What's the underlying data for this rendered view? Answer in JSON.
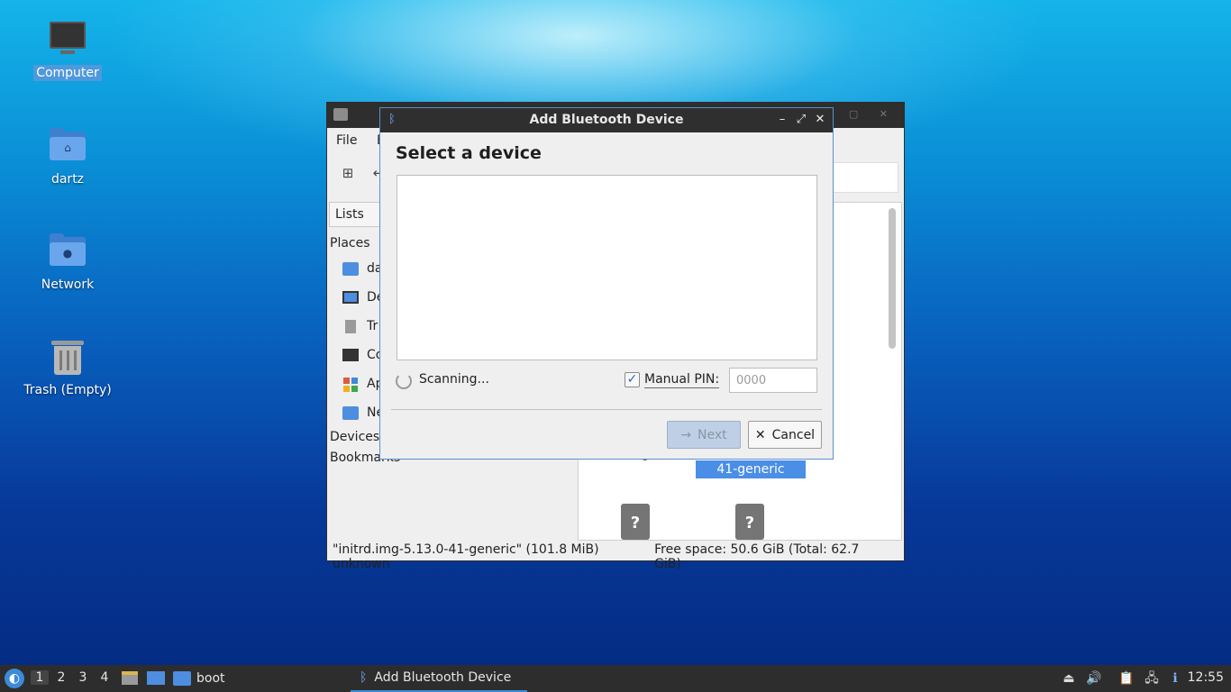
{
  "desktop": {
    "icons": [
      {
        "label": "Computer",
        "icon": "computer-icon",
        "selected": true
      },
      {
        "label": "dartz",
        "icon": "home-folder-icon"
      },
      {
        "label": "Network",
        "icon": "network-folder-icon"
      },
      {
        "label": "Trash (Empty)",
        "icon": "trash-icon"
      }
    ]
  },
  "file_manager": {
    "menu": [
      "File",
      "E"
    ],
    "side_tab": "Lists",
    "places_heading": "Places",
    "places": [
      {
        "label": "da",
        "icon": "home-folder-icon"
      },
      {
        "label": "De",
        "icon": "desktop-icon"
      },
      {
        "label": "Tr",
        "icon": "trash-icon"
      },
      {
        "label": "Co",
        "icon": "computer-icon"
      },
      {
        "label": "Ap",
        "icon": "applications-icon"
      },
      {
        "label": "Ne",
        "icon": "network-folder-icon"
      }
    ],
    "devices_heading": "Devices",
    "bookmarks_heading": "Bookmarks",
    "selected_file_label": "41-generic",
    "above_file_label": "g",
    "unknown_file_glyph": "?",
    "status_left": "\"initrd.img-5.13.0-41-generic\" (101.8 MiB) unknown",
    "status_right": "Free space: 50.6 GiB (Total: 62.7 GiB)"
  },
  "dialog": {
    "title": "Add Bluetooth Device",
    "heading": "Select a device",
    "scanning_text": "Scanning...",
    "manual_pin_label": "Manual PIN:",
    "manual_pin_checked": true,
    "pin_placeholder": "0000",
    "next_label": "Next",
    "cancel_label": "Cancel"
  },
  "taskbar": {
    "workspaces": [
      "1",
      "2",
      "3",
      "4"
    ],
    "active_workspace": "1",
    "tasks": [
      {
        "label": "boot",
        "icon": "folder-icon"
      },
      {
        "label": "Add Bluetooth Device",
        "icon": "bluetooth-icon",
        "active": true
      }
    ],
    "clock": "12:55"
  },
  "colors": {
    "accent": "#3c8ad8",
    "selection": "#4a8ee6",
    "titlebar": "#2f2f2f"
  }
}
